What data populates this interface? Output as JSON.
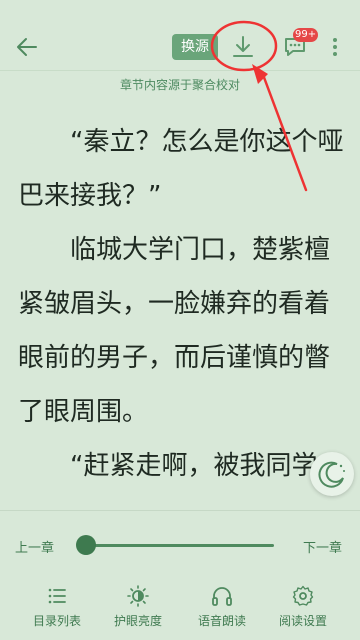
{
  "header": {
    "swap_label": "换源",
    "badge_count": "99+"
  },
  "source_text": "章节内容源于聚合校对",
  "content": {
    "paragraphs": [
      "“秦立？怎么是你这个哑巴来接我？”",
      "临城大学门口，楚紫檀紧皱眉头，一脸嫌弃的看着眼前的男子，而后谨慎的瞥了眼周围。",
      "“赶紧走啊，被我同学"
    ]
  },
  "progress": {
    "prev_label": "上一章",
    "next_label": "下一章",
    "fraction": 0.0
  },
  "bottom_nav": {
    "items": [
      {
        "label": "目录列表",
        "icon": "list-icon"
      },
      {
        "label": "护眼亮度",
        "icon": "brightness-icon"
      },
      {
        "label": "语音朗读",
        "icon": "headphones-icon"
      },
      {
        "label": "阅读设置",
        "icon": "gear-icon"
      }
    ]
  },
  "colors": {
    "background": "#d8e8d8",
    "accent": "#6aa57a",
    "annotation": "#e33"
  }
}
